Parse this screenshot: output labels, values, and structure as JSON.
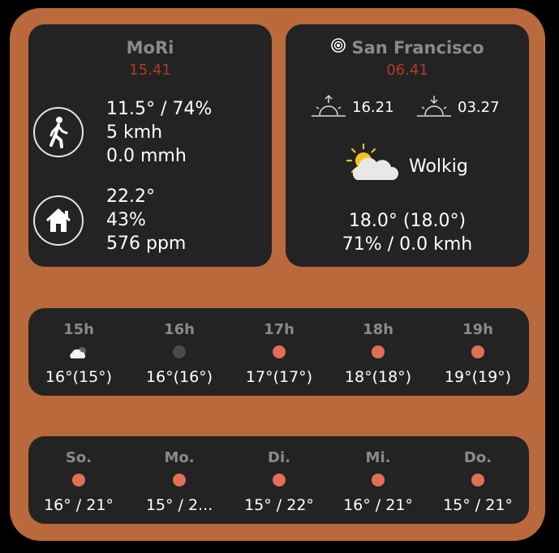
{
  "colors": {
    "widget_bg": "#b9693c",
    "panel_bg": "#232323",
    "label_gray": "#8a8a8a",
    "time_red": "#b23a2e",
    "dot_orange": "#e07055",
    "dot_dark": "#4a4a4a"
  },
  "home": {
    "title": "MoRi",
    "time": "15.41",
    "outdoor": {
      "icon": "walking-person-icon",
      "line1": "11.5° / 74%",
      "line2": "5 kmh",
      "line3": "0.0 mmh"
    },
    "indoor": {
      "icon": "house-icon",
      "line1": "22.2°",
      "line2": "43%",
      "line3": "576 ppm"
    }
  },
  "city": {
    "location_icon": "location-target-icon",
    "title": "San Francisco",
    "time": "06.41",
    "sunrise": "16.21",
    "sunset": "03.27",
    "condition_icon": "partly-cloudy-icon",
    "condition": "Wolkig",
    "temp_line": "18.0° (18.0°)",
    "humidity_wind": "71% / 0.0 kmh"
  },
  "hourly": [
    {
      "label": "15h",
      "icon": "partly-cloudy-night-icon",
      "temp": "16°(15°)"
    },
    {
      "label": "16h",
      "icon": "dark-dot",
      "temp": "16°(16°)"
    },
    {
      "label": "17h",
      "icon": "orange-dot",
      "temp": "17°(17°)"
    },
    {
      "label": "18h",
      "icon": "orange-dot",
      "temp": "18°(18°)"
    },
    {
      "label": "19h",
      "icon": "orange-dot",
      "temp": "19°(19°)"
    }
  ],
  "daily": [
    {
      "label": "So.",
      "icon": "orange-dot",
      "temp": "16° / 21°"
    },
    {
      "label": "Mo.",
      "icon": "orange-dot",
      "temp": "15° / 2..."
    },
    {
      "label": "Di.",
      "icon": "orange-dot",
      "temp": "15° / 22°"
    },
    {
      "label": "Mi.",
      "icon": "orange-dot",
      "temp": "16° / 21°"
    },
    {
      "label": "Do.",
      "icon": "orange-dot",
      "temp": "15° / 21°"
    }
  ]
}
